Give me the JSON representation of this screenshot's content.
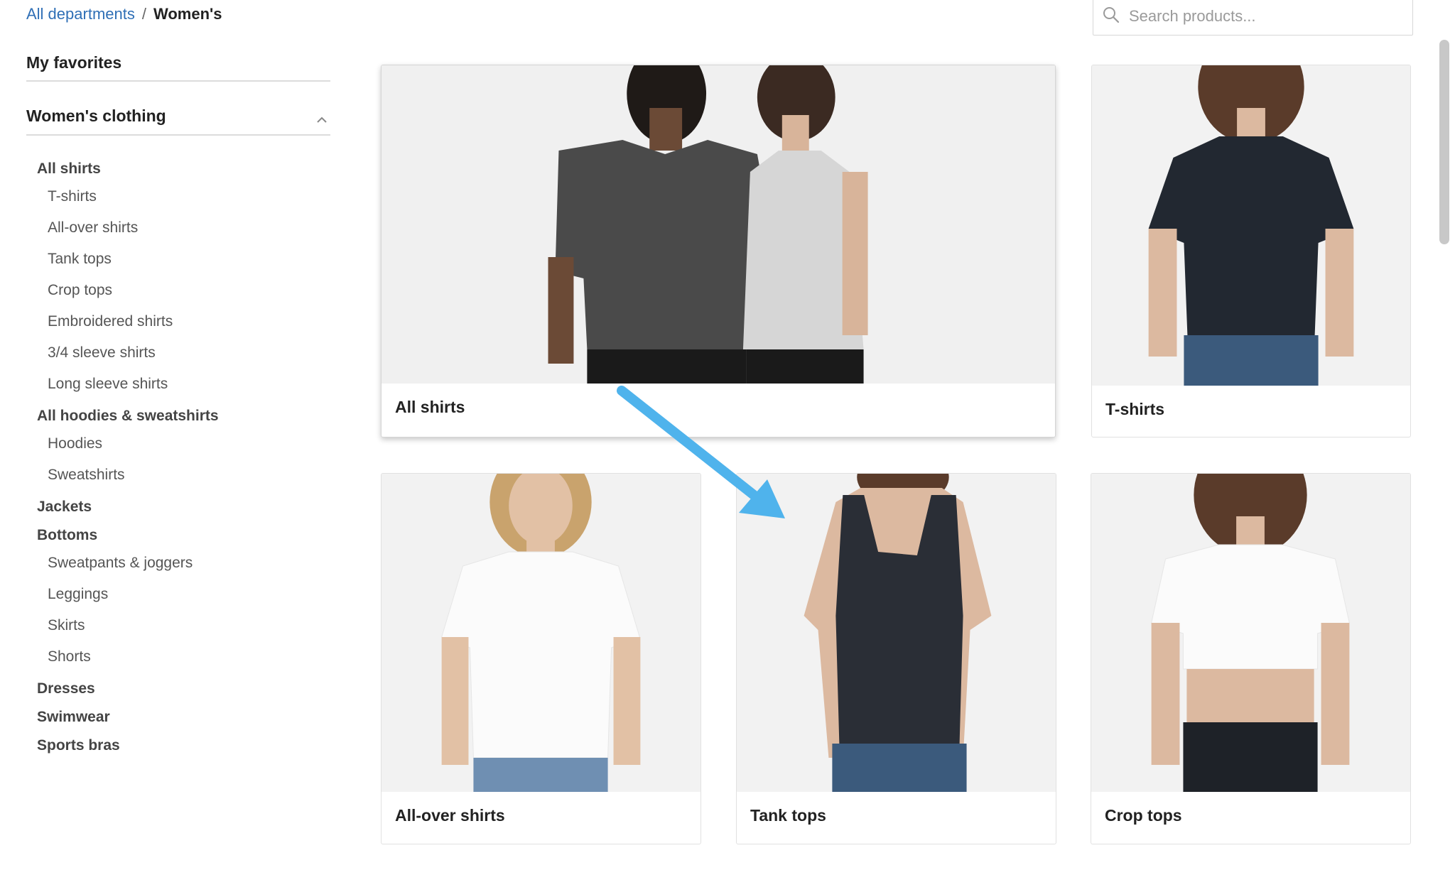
{
  "breadcrumb": {
    "parent": "All departments",
    "separator": "/",
    "current": "Women's"
  },
  "search": {
    "placeholder": "Search products...",
    "value": "",
    "icon": "search-icon"
  },
  "sidebar": {
    "favorites": "My favorites",
    "section_title": "Women's clothing",
    "section_icon": "chevron-up-icon",
    "groups": [
      {
        "label": "All shirts",
        "items": [
          "T-shirts",
          "All-over shirts",
          "Tank tops",
          "Crop tops",
          "Embroidered shirts",
          "3/4 sleeve shirts",
          "Long sleeve shirts"
        ]
      },
      {
        "label": "All hoodies & sweatshirts",
        "items": [
          "Hoodies",
          "Sweatshirts"
        ]
      },
      {
        "label": "Jackets",
        "items": []
      },
      {
        "label": "Bottoms",
        "items": [
          "Sweatpants & joggers",
          "Leggings",
          "Skirts",
          "Shorts"
        ]
      },
      {
        "label": "Dresses",
        "items": []
      },
      {
        "label": "Swimwear",
        "items": []
      },
      {
        "label": "Sports bras",
        "items": []
      }
    ]
  },
  "grid": {
    "cards": [
      {
        "label": "All shirts"
      },
      {
        "label": "T-shirts"
      },
      {
        "label": "All-over shirts"
      },
      {
        "label": "Tank tops"
      },
      {
        "label": "Crop tops"
      }
    ]
  },
  "colors": {
    "link": "#2f6fb6",
    "annotation_arrow": "#4fb3ec",
    "photo_bg": "#f1f1f1"
  }
}
